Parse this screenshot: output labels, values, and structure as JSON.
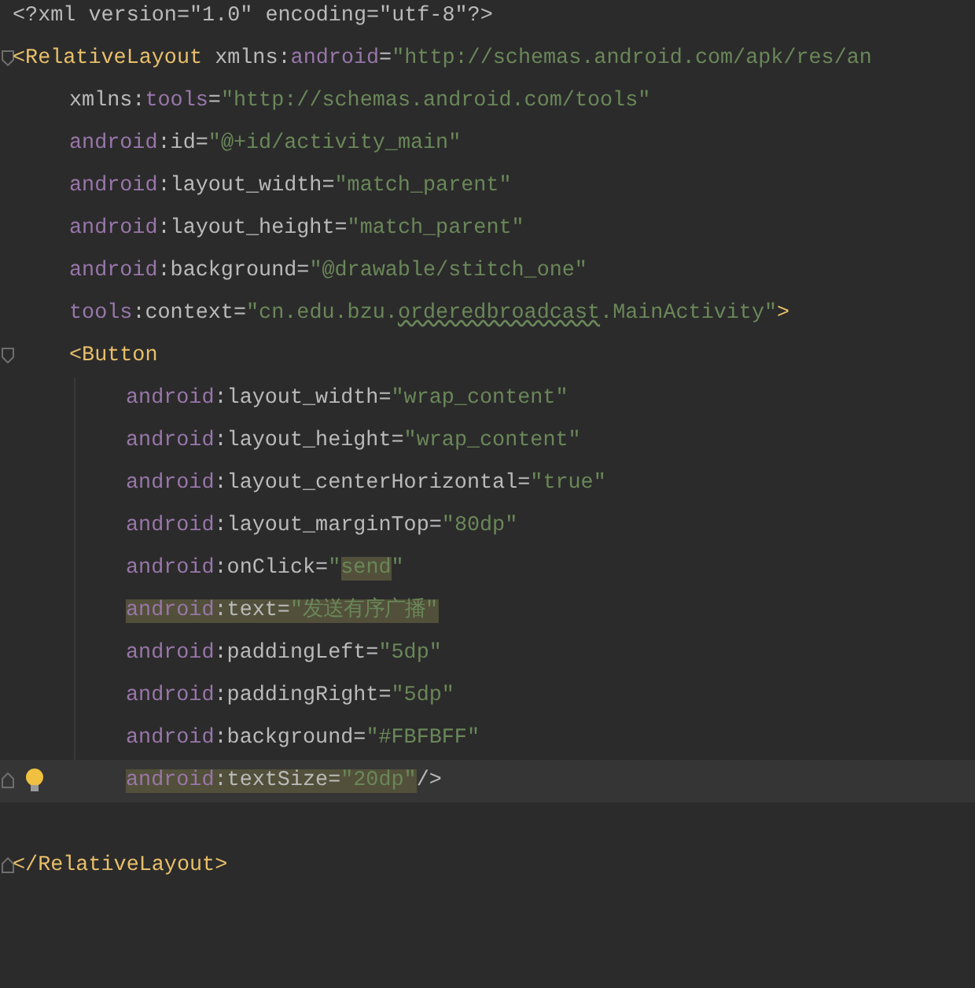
{
  "editor": {
    "lines": [
      {
        "tokens": [
          {
            "kind": "punct",
            "text": "<?xml version=\"1.0\" encoding=\"utf-8\"?>"
          }
        ]
      },
      {
        "fold_open": true,
        "tokens": [
          {
            "kind": "tag",
            "text": "<RelativeLayout "
          },
          {
            "kind": "attr",
            "text": "xmlns:"
          },
          {
            "kind": "ns",
            "text": "android"
          },
          {
            "kind": "attr",
            "text": "="
          },
          {
            "kind": "value",
            "text": "\"http://schemas.android.com/apk/res/an"
          }
        ],
        "children": [
          {
            "tokens": [
              {
                "kind": "attr",
                "text": "xmlns:"
              },
              {
                "kind": "ns",
                "text": "tools"
              },
              {
                "kind": "attr",
                "text": "="
              },
              {
                "kind": "value",
                "text": "\"http://schemas.android.com/tools\""
              }
            ]
          },
          {
            "tokens": [
              {
                "kind": "ns",
                "text": "android"
              },
              {
                "kind": "attr",
                "text": ":id="
              },
              {
                "kind": "value",
                "text": "\"@+id/activity_main\""
              }
            ]
          },
          {
            "tokens": [
              {
                "kind": "ns",
                "text": "android"
              },
              {
                "kind": "attr",
                "text": ":layout_width="
              },
              {
                "kind": "value",
                "text": "\"match_parent\""
              }
            ]
          },
          {
            "tokens": [
              {
                "kind": "ns",
                "text": "android"
              },
              {
                "kind": "attr",
                "text": ":layout_height="
              },
              {
                "kind": "value",
                "text": "\"match_parent\""
              }
            ]
          },
          {
            "tokens": [
              {
                "kind": "ns",
                "text": "android"
              },
              {
                "kind": "attr",
                "text": ":background="
              },
              {
                "kind": "value",
                "text": "\"@drawable/stitch_one\""
              }
            ]
          },
          {
            "tokens": [
              {
                "kind": "ns",
                "text": "tools"
              },
              {
                "kind": "attr",
                "text": ":context="
              },
              {
                "kind": "value",
                "text": "\"cn.edu.bzu."
              },
              {
                "kind": "value",
                "text": "orderedbroadcast",
                "underlined": true
              },
              {
                "kind": "value",
                "text": ".MainActivity\""
              },
              {
                "kind": "tag",
                "text": ">"
              }
            ]
          },
          {
            "fold_open": true,
            "tokens": [
              {
                "kind": "tag",
                "text": "<Button"
              }
            ],
            "children": [
              {
                "tokens": [
                  {
                    "kind": "ns",
                    "text": "android"
                  },
                  {
                    "kind": "attr",
                    "text": ":layout_width="
                  },
                  {
                    "kind": "value",
                    "text": "\"wrap_content\""
                  }
                ]
              },
              {
                "tokens": [
                  {
                    "kind": "ns",
                    "text": "android"
                  },
                  {
                    "kind": "attr",
                    "text": ":layout_height="
                  },
                  {
                    "kind": "value",
                    "text": "\"wrap_content\""
                  }
                ]
              },
              {
                "tokens": [
                  {
                    "kind": "ns",
                    "text": "android"
                  },
                  {
                    "kind": "attr",
                    "text": ":layout_centerHorizontal="
                  },
                  {
                    "kind": "value",
                    "text": "\"true\""
                  }
                ]
              },
              {
                "tokens": [
                  {
                    "kind": "ns",
                    "text": "android"
                  },
                  {
                    "kind": "attr",
                    "text": ":layout_marginTop="
                  },
                  {
                    "kind": "value",
                    "text": "\"80dp\""
                  }
                ]
              },
              {
                "tokens": [
                  {
                    "kind": "ns",
                    "text": "android"
                  },
                  {
                    "kind": "attr",
                    "text": ":onClick="
                  },
                  {
                    "kind": "value",
                    "text": "\""
                  },
                  {
                    "kind": "value",
                    "text": "send",
                    "highlighted": true
                  },
                  {
                    "kind": "value",
                    "text": "\""
                  }
                ]
              },
              {
                "tokens": [
                  {
                    "kind": "ns",
                    "text": "android",
                    "highlighted": true
                  },
                  {
                    "kind": "attr",
                    "text": ":text=",
                    "highlighted": true
                  },
                  {
                    "kind": "value",
                    "text": "\"发送有序广播\"",
                    "highlighted": true
                  }
                ]
              },
              {
                "tokens": [
                  {
                    "kind": "ns",
                    "text": "android"
                  },
                  {
                    "kind": "attr",
                    "text": ":paddingLeft="
                  },
                  {
                    "kind": "value",
                    "text": "\"5dp\""
                  }
                ]
              },
              {
                "tokens": [
                  {
                    "kind": "ns",
                    "text": "android"
                  },
                  {
                    "kind": "attr",
                    "text": ":paddingRight="
                  },
                  {
                    "kind": "value",
                    "text": "\"5dp\""
                  }
                ]
              },
              {
                "tokens": [
                  {
                    "kind": "ns",
                    "text": "android"
                  },
                  {
                    "kind": "attr",
                    "text": ":background="
                  },
                  {
                    "kind": "value",
                    "text": "\"#FBFBFF\""
                  }
                ]
              },
              {
                "fold_close": true,
                "current": true,
                "tokens": [
                  {
                    "kind": "ns",
                    "text": "android",
                    "highlighted": true
                  },
                  {
                    "kind": "attr",
                    "text": ":textSize=",
                    "highlighted": true
                  },
                  {
                    "kind": "value",
                    "text": "\"20dp\"",
                    "highlighted": true
                  },
                  {
                    "kind": "attr",
                    "text": "/>"
                  }
                ]
              }
            ]
          }
        ]
      },
      {
        "fold_close": true,
        "tokens": [
          {
            "kind": "tag",
            "text": "</RelativeLayout>"
          }
        ]
      }
    ]
  }
}
